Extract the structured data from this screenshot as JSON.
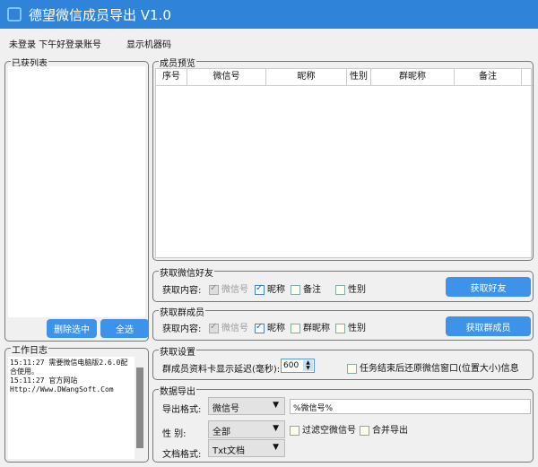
{
  "app": {
    "title": "德望微信成员导出 V1.0"
  },
  "menu": {
    "status": "未登录 下午好",
    "login": "登录账号",
    "machine_code": "显示机器码"
  },
  "left": {
    "list_title": "已获列表",
    "delete_btn": "删除选中",
    "select_all_btn": "全选"
  },
  "log": {
    "title": "工作日志",
    "lines": [
      "15:11:27  需要微信电脑版2.6.0配合使用。",
      "15:11:27  官方网站",
      "Http://Www.DWangSoft.Com"
    ]
  },
  "preview": {
    "title": "成员预览",
    "columns": [
      "序号",
      "微信号",
      "昵称",
      "性别",
      "群昵称",
      "备注"
    ]
  },
  "friends": {
    "title": "获取微信好友",
    "label": "获取内容:",
    "opts": [
      "微信号",
      "昵称",
      "备注",
      "性别"
    ],
    "checked": [
      true,
      true,
      false,
      false
    ],
    "button": "获取好友"
  },
  "members": {
    "title": "获取群成员",
    "label": "获取内容:",
    "opts": [
      "微信号",
      "昵称",
      "群昵称",
      "性别"
    ],
    "checked": [
      true,
      true,
      false,
      false
    ],
    "button": "获取群成员"
  },
  "settings": {
    "title": "获取设置",
    "delay_label": "群成员资料卡显示延迟(毫秒):",
    "delay_value": "600",
    "restore_label": "任务结束后还原微信窗口(位置大小)信息"
  },
  "export": {
    "title": "数据导出",
    "format_label": "导出格式:",
    "format_value": "微信号",
    "template_value": "%微信号%",
    "gender_label": "性  别:",
    "gender_value": "全部",
    "filter_label": "过滤空微信号",
    "merge_label": "合并导出",
    "doc_label": "文档格式:",
    "doc_value": "Txt文档"
  },
  "colors": {
    "titlebar": "#2f84d9",
    "button": "#3d92ea"
  }
}
